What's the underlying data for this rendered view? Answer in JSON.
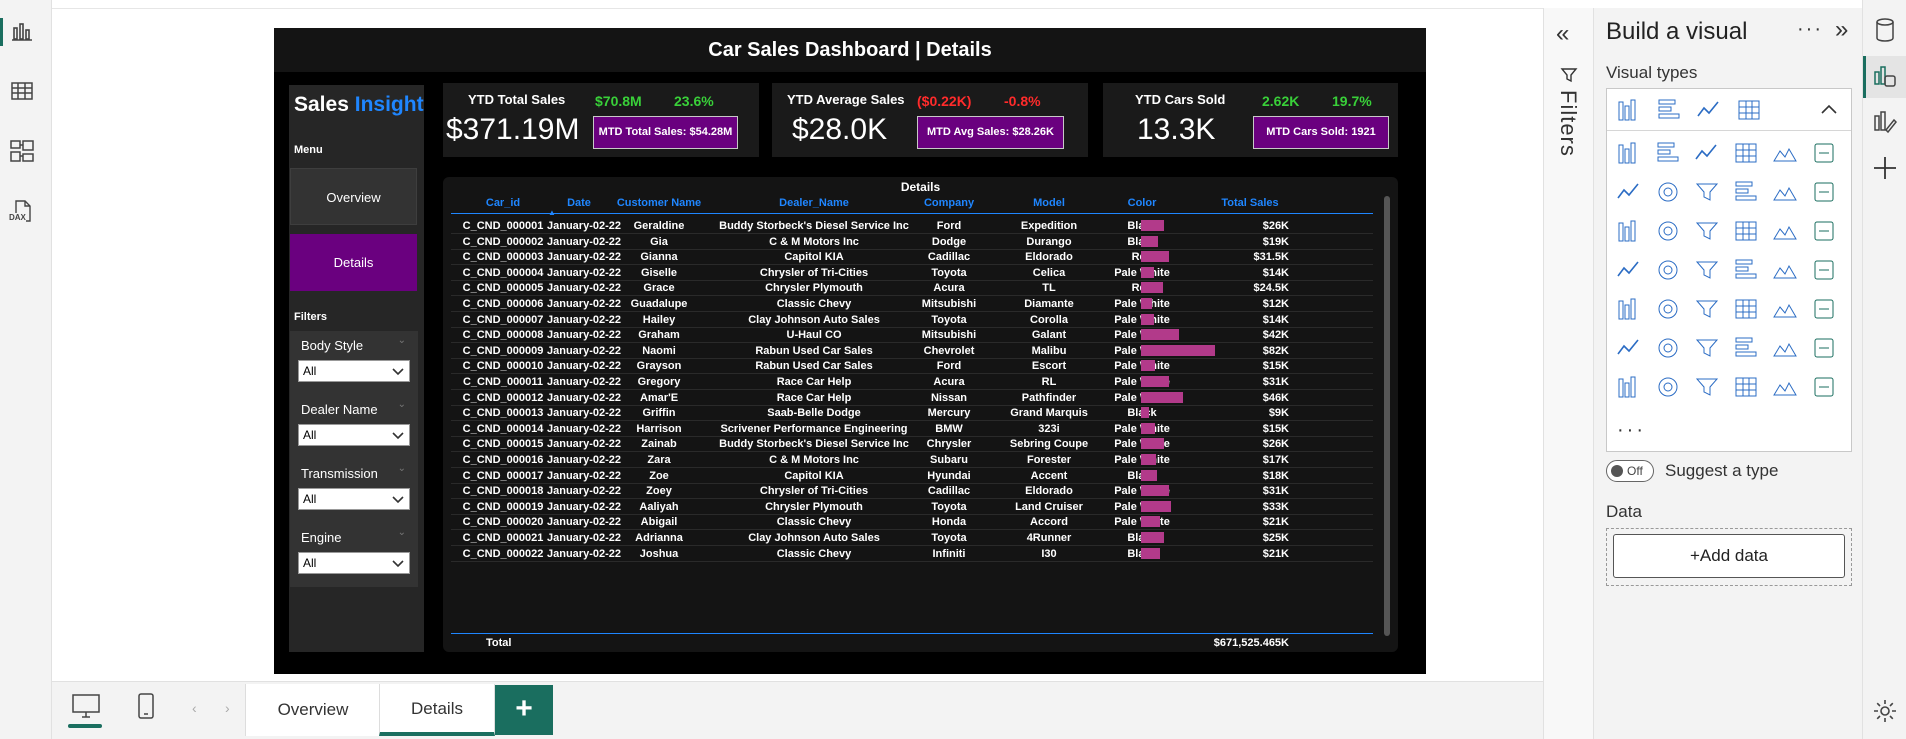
{
  "left_rail": {
    "icons": [
      "report-view-icon",
      "table-view-icon",
      "model-view-icon",
      "dax-query-view-icon"
    ],
    "dax_label": "DAX"
  },
  "report": {
    "title": "Car Sales Dashboard | Details",
    "brand": {
      "part1": "Sales",
      "part2": "Insight"
    },
    "menu_label": "Menu",
    "nav": {
      "overview": "Overview",
      "details": "Details"
    },
    "filters_label": "Filters",
    "slicers": [
      {
        "title": "Body Style",
        "value": "All"
      },
      {
        "title": "Dealer Name",
        "value": "All"
      },
      {
        "title": "Transmission",
        "value": "All"
      },
      {
        "title": "Engine",
        "value": "All"
      }
    ],
    "kpis": [
      {
        "label": "YTD Total Sales",
        "big": "$371.19M",
        "v1": "$70.8M",
        "v2": "23.6%",
        "mtd": "MTD Total Sales: $54.28M",
        "color": "#39d039"
      },
      {
        "label": "YTD Average Sales",
        "big": "$28.0K",
        "v1": "($0.22K)",
        "v2": "-0.8%",
        "mtd": "MTD Avg Sales: $28.26K",
        "color": "#ff2b2b"
      },
      {
        "label": "YTD Cars Sold",
        "big": "13.3K",
        "v1": "2.62K",
        "v2": "19.7%",
        "mtd": "MTD Cars Sold: 1921",
        "color": "#39d039"
      }
    ],
    "table": {
      "title": "Details",
      "columns": [
        "Car_id",
        "Date",
        "Customer Name",
        "Dealer_Name",
        "Company",
        "Model",
        "Color",
        "Total Sales"
      ],
      "rows": [
        [
          "C_CND_000001",
          "January-02-22",
          "Geraldine",
          "Buddy Storbeck's Diesel Service Inc",
          "Ford",
          "Expedition",
          "Black",
          "$26K",
          26
        ],
        [
          "C_CND_000002",
          "January-02-22",
          "Gia",
          "C & M Motors Inc",
          "Dodge",
          "Durango",
          "Black",
          "$19K",
          19
        ],
        [
          "C_CND_000003",
          "January-02-22",
          "Gianna",
          "Capitol KIA",
          "Cadillac",
          "Eldorado",
          "Red",
          "$31.5K",
          31.5
        ],
        [
          "C_CND_000004",
          "January-02-22",
          "Giselle",
          "Chrysler of Tri-Cities",
          "Toyota",
          "Celica",
          "Pale White",
          "$14K",
          14
        ],
        [
          "C_CND_000005",
          "January-02-22",
          "Grace",
          "Chrysler Plymouth",
          "Acura",
          "TL",
          "Red",
          "$24.5K",
          24.5
        ],
        [
          "C_CND_000006",
          "January-02-22",
          "Guadalupe",
          "Classic Chevy",
          "Mitsubishi",
          "Diamante",
          "Pale White",
          "$12K",
          12
        ],
        [
          "C_CND_000007",
          "January-02-22",
          "Hailey",
          "Clay Johnson Auto Sales",
          "Toyota",
          "Corolla",
          "Pale White",
          "$14K",
          14
        ],
        [
          "C_CND_000008",
          "January-02-22",
          "Graham",
          "U-Haul CO",
          "Mitsubishi",
          "Galant",
          "Pale White",
          "$42K",
          42
        ],
        [
          "C_CND_000009",
          "January-02-22",
          "Naomi",
          "Rabun Used Car Sales",
          "Chevrolet",
          "Malibu",
          "Pale White",
          "$82K",
          82
        ],
        [
          "C_CND_000010",
          "January-02-22",
          "Grayson",
          "Rabun Used Car Sales",
          "Ford",
          "Escort",
          "Pale White",
          "$15K",
          15
        ],
        [
          "C_CND_000011",
          "January-02-22",
          "Gregory",
          "Race Car Help",
          "Acura",
          "RL",
          "Pale White",
          "$31K",
          31
        ],
        [
          "C_CND_000012",
          "January-02-22",
          "Amar'E",
          "Race Car Help",
          "Nissan",
          "Pathfinder",
          "Pale White",
          "$46K",
          46
        ],
        [
          "C_CND_000013",
          "January-02-22",
          "Griffin",
          "Saab-Belle Dodge",
          "Mercury",
          "Grand Marquis",
          "Black",
          "$9K",
          9
        ],
        [
          "C_CND_000014",
          "January-02-22",
          "Harrison",
          "Scrivener Performance Engineering",
          "BMW",
          "323i",
          "Pale White",
          "$15K",
          15
        ],
        [
          "C_CND_000015",
          "January-02-22",
          "Zainab",
          "Buddy Storbeck's Diesel Service Inc",
          "Chrysler",
          "Sebring Coupe",
          "Pale White",
          "$26K",
          26
        ],
        [
          "C_CND_000016",
          "January-02-22",
          "Zara",
          "C & M Motors Inc",
          "Subaru",
          "Forester",
          "Pale White",
          "$17K",
          17
        ],
        [
          "C_CND_000017",
          "January-02-22",
          "Zoe",
          "Capitol KIA",
          "Hyundai",
          "Accent",
          "Black",
          "$18K",
          18
        ],
        [
          "C_CND_000018",
          "January-02-22",
          "Zoey",
          "Chrysler of Tri-Cities",
          "Cadillac",
          "Eldorado",
          "Pale White",
          "$31K",
          31
        ],
        [
          "C_CND_000019",
          "January-02-22",
          "Aaliyah",
          "Chrysler Plymouth",
          "Toyota",
          "Land Cruiser",
          "Pale White",
          "$33K",
          33
        ],
        [
          "C_CND_000020",
          "January-02-22",
          "Abigail",
          "Classic Chevy",
          "Honda",
          "Accord",
          "Pale White",
          "$21K",
          21
        ],
        [
          "C_CND_000021",
          "January-02-22",
          "Adrianna",
          "Clay Johnson Auto Sales",
          "Toyota",
          "4Runner",
          "Black",
          "$25K",
          25
        ],
        [
          "C_CND_000022",
          "January-02-22",
          "Joshua",
          "Classic Chevy",
          "Infiniti",
          "I30",
          "Black",
          "$21K",
          21
        ]
      ],
      "bar_max": 82,
      "bar_color": "#b23a8a",
      "total_label": "Total",
      "total_value": "$671,525.465K"
    }
  },
  "page_bar": {
    "tabs": [
      "Overview",
      "Details"
    ],
    "active_tab": "Details",
    "add_label": "+"
  },
  "filters_pane": {
    "label": "Filters"
  },
  "viz_pane": {
    "title": "Build a visual",
    "more": "···",
    "visual_types_label": "Visual types",
    "suggest_toggle": "Off",
    "suggest_label": "Suggest a type",
    "data_label": "Data",
    "add_data": "+Add data",
    "more_visuals": "···"
  },
  "accent": "#1a6e5f",
  "highlight_purple": "#6a007f",
  "link_blue": "#1f86ff"
}
